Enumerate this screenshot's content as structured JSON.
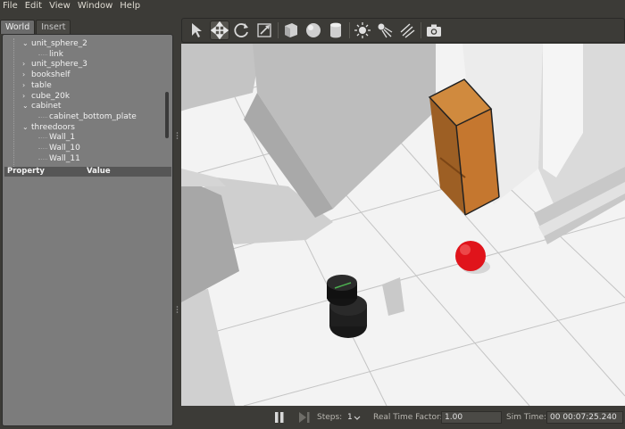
{
  "menu": [
    "File",
    "Edit",
    "View",
    "Window",
    "Help"
  ],
  "tabs": [
    {
      "label": "World",
      "active": true
    },
    {
      "label": "Insert",
      "active": false
    }
  ],
  "tree": [
    {
      "label": "unit_sphere_2",
      "level": 1,
      "arrow": "down"
    },
    {
      "label": "link",
      "level": 2,
      "arrow": ""
    },
    {
      "label": "unit_sphere_3",
      "level": 1,
      "arrow": "right"
    },
    {
      "label": "bookshelf",
      "level": 1,
      "arrow": "right"
    },
    {
      "label": "table",
      "level": 1,
      "arrow": "right"
    },
    {
      "label": "cube_20k",
      "level": 1,
      "arrow": "right"
    },
    {
      "label": "cabinet",
      "level": 1,
      "arrow": "down"
    },
    {
      "label": "cabinet_bottom_plate",
      "level": 2,
      "arrow": ""
    },
    {
      "label": "threedoors",
      "level": 1,
      "arrow": "down"
    },
    {
      "label": "Wall_1",
      "level": 2,
      "arrow": ""
    },
    {
      "label": "Wall_10",
      "level": 2,
      "arrow": ""
    },
    {
      "label": "Wall_11",
      "level": 2,
      "arrow": ""
    }
  ],
  "property_header": {
    "property": "Property",
    "value": "Value"
  },
  "toolbar": {
    "tools": [
      {
        "icon": "select-arrow-icon",
        "active": false
      },
      {
        "icon": "translate-icon",
        "active": true
      },
      {
        "icon": "rotate-icon",
        "active": false
      },
      {
        "icon": "scale-icon",
        "active": false
      },
      {
        "sep": true
      },
      {
        "icon": "box-shape-icon",
        "active": false
      },
      {
        "icon": "sphere-shape-icon",
        "active": false
      },
      {
        "icon": "cylinder-shape-icon",
        "active": false
      },
      {
        "sep": true
      },
      {
        "icon": "point-light-icon",
        "active": false
      },
      {
        "icon": "spot-light-icon",
        "active": false
      },
      {
        "icon": "directional-light-icon",
        "active": false
      },
      {
        "sep": true
      },
      {
        "icon": "screenshot-icon",
        "active": false
      }
    ]
  },
  "bottom": {
    "steps_label": "Steps:",
    "steps_value": "1",
    "rtf_label": "Real Time Factor:",
    "rtf_value": "1.00",
    "simtime_label": "Sim Time:",
    "simtime_value": "00 00:07:25.240"
  },
  "colors": {
    "bookshelf": "#b3722f",
    "ball": "#e0141b",
    "floor": "#f4f4f4",
    "wall": "#bdbdbd"
  }
}
